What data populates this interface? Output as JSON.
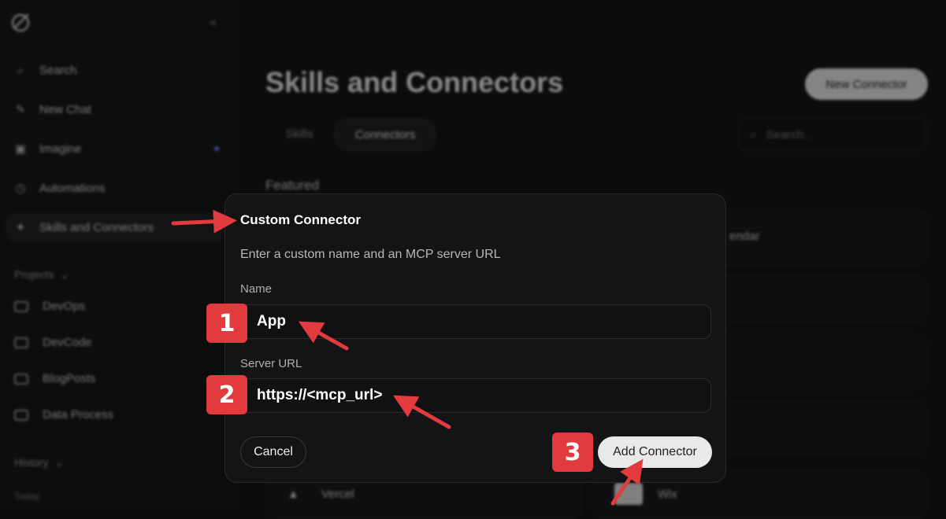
{
  "sidebar": {
    "items": [
      {
        "label": "Search",
        "icon": "search-icon"
      },
      {
        "label": "New Chat",
        "icon": "edit-icon"
      },
      {
        "label": "Imagine",
        "icon": "image-icon"
      },
      {
        "label": "Automations",
        "icon": "clock-icon"
      },
      {
        "label": "Skills and Connectors",
        "icon": "puzzle-icon"
      }
    ],
    "projects_label": "Projects",
    "projects": [
      "DevOps",
      "DevCode",
      "BlogPosts",
      "Data Process"
    ],
    "history_label": "History",
    "today_label": "Today"
  },
  "main": {
    "title": "Skills and Connectors",
    "new_connector_label": "New Connector",
    "tabs": [
      {
        "label": "Skills"
      },
      {
        "label": "Connectors"
      }
    ],
    "search_placeholder": "Search...",
    "featured_label": "Featured",
    "featured_items": [
      "endar",
      "Vercel",
      "Wix"
    ]
  },
  "modal": {
    "title": "Custom Connector",
    "subtitle": "Enter a custom name and an MCP server URL",
    "name_label": "Name",
    "name_value": "App",
    "url_label": "Server URL",
    "url_value": "https://<mcp_url>",
    "cancel_label": "Cancel",
    "add_label": "Add Connector"
  },
  "annotations": {
    "badges": [
      "1",
      "2",
      "3"
    ],
    "accent_color": "#e23b3f"
  }
}
